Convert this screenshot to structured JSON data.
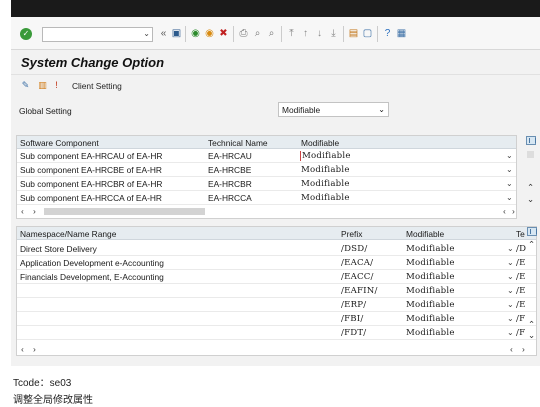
{
  "toolbar": {
    "icons": [
      "enter-icon",
      "back-icon",
      "save-icon",
      "green-back-icon",
      "exit-icon",
      "cancel-icon",
      "print-icon",
      "find-icon",
      "find-next-icon",
      "first-page-icon",
      "prev-page-icon",
      "next-page-icon",
      "last-page-icon",
      "new-session-icon",
      "shortcut-icon",
      "help-icon",
      "customize-icon"
    ]
  },
  "page": {
    "title": "System Change Option",
    "client_setting": "Client Setting"
  },
  "global": {
    "label": "Global Setting",
    "value": "Modifiable"
  },
  "components": {
    "headers": [
      "Software Component",
      "Technical Name",
      "Modifiable"
    ],
    "rows": [
      {
        "name": "Sub component EA-HRCAU of EA-HR",
        "tech": "EA-HRCAU",
        "mod": "Modifiable"
      },
      {
        "name": "Sub component EA-HRCBE of EA-HR",
        "tech": "EA-HRCBE",
        "mod": "Modifiable"
      },
      {
        "name": "Sub component EA-HRCBR of EA-HR",
        "tech": "EA-HRCBR",
        "mod": "Modifiable"
      },
      {
        "name": "Sub component EA-HRCCA of EA-HR",
        "tech": "EA-HRCCA",
        "mod": "Modifiable"
      }
    ]
  },
  "namespaces": {
    "headers": [
      "Namespace/Name Range",
      "Prefix",
      "Modifiable",
      "Te"
    ],
    "rows": [
      {
        "name": "Direct Store Delivery",
        "prefix": "/DSD/",
        "mod": "Modifiable",
        "te": "/D"
      },
      {
        "name": "Application Development e-Accounting",
        "prefix": "/EACA/",
        "mod": "Modifiable",
        "te": "/E"
      },
      {
        "name": "Financials Development, E-Accounting",
        "prefix": "/EACC/",
        "mod": "Modifiable",
        "te": "/E"
      },
      {
        "name": "",
        "prefix": "/EAFIN/",
        "mod": "Modifiable",
        "te": "/E"
      },
      {
        "name": "",
        "prefix": "/ERP/",
        "mod": "Modifiable",
        "te": "/E"
      },
      {
        "name": "",
        "prefix": "/FBI/",
        "mod": "Modifiable",
        "te": "/F"
      },
      {
        "name": "",
        "prefix": "/FDT/",
        "mod": "Modifiable",
        "te": "/F"
      }
    ]
  },
  "caption": {
    "tcode": "Tcode：se03",
    "desc": "调整全局修改属性"
  }
}
